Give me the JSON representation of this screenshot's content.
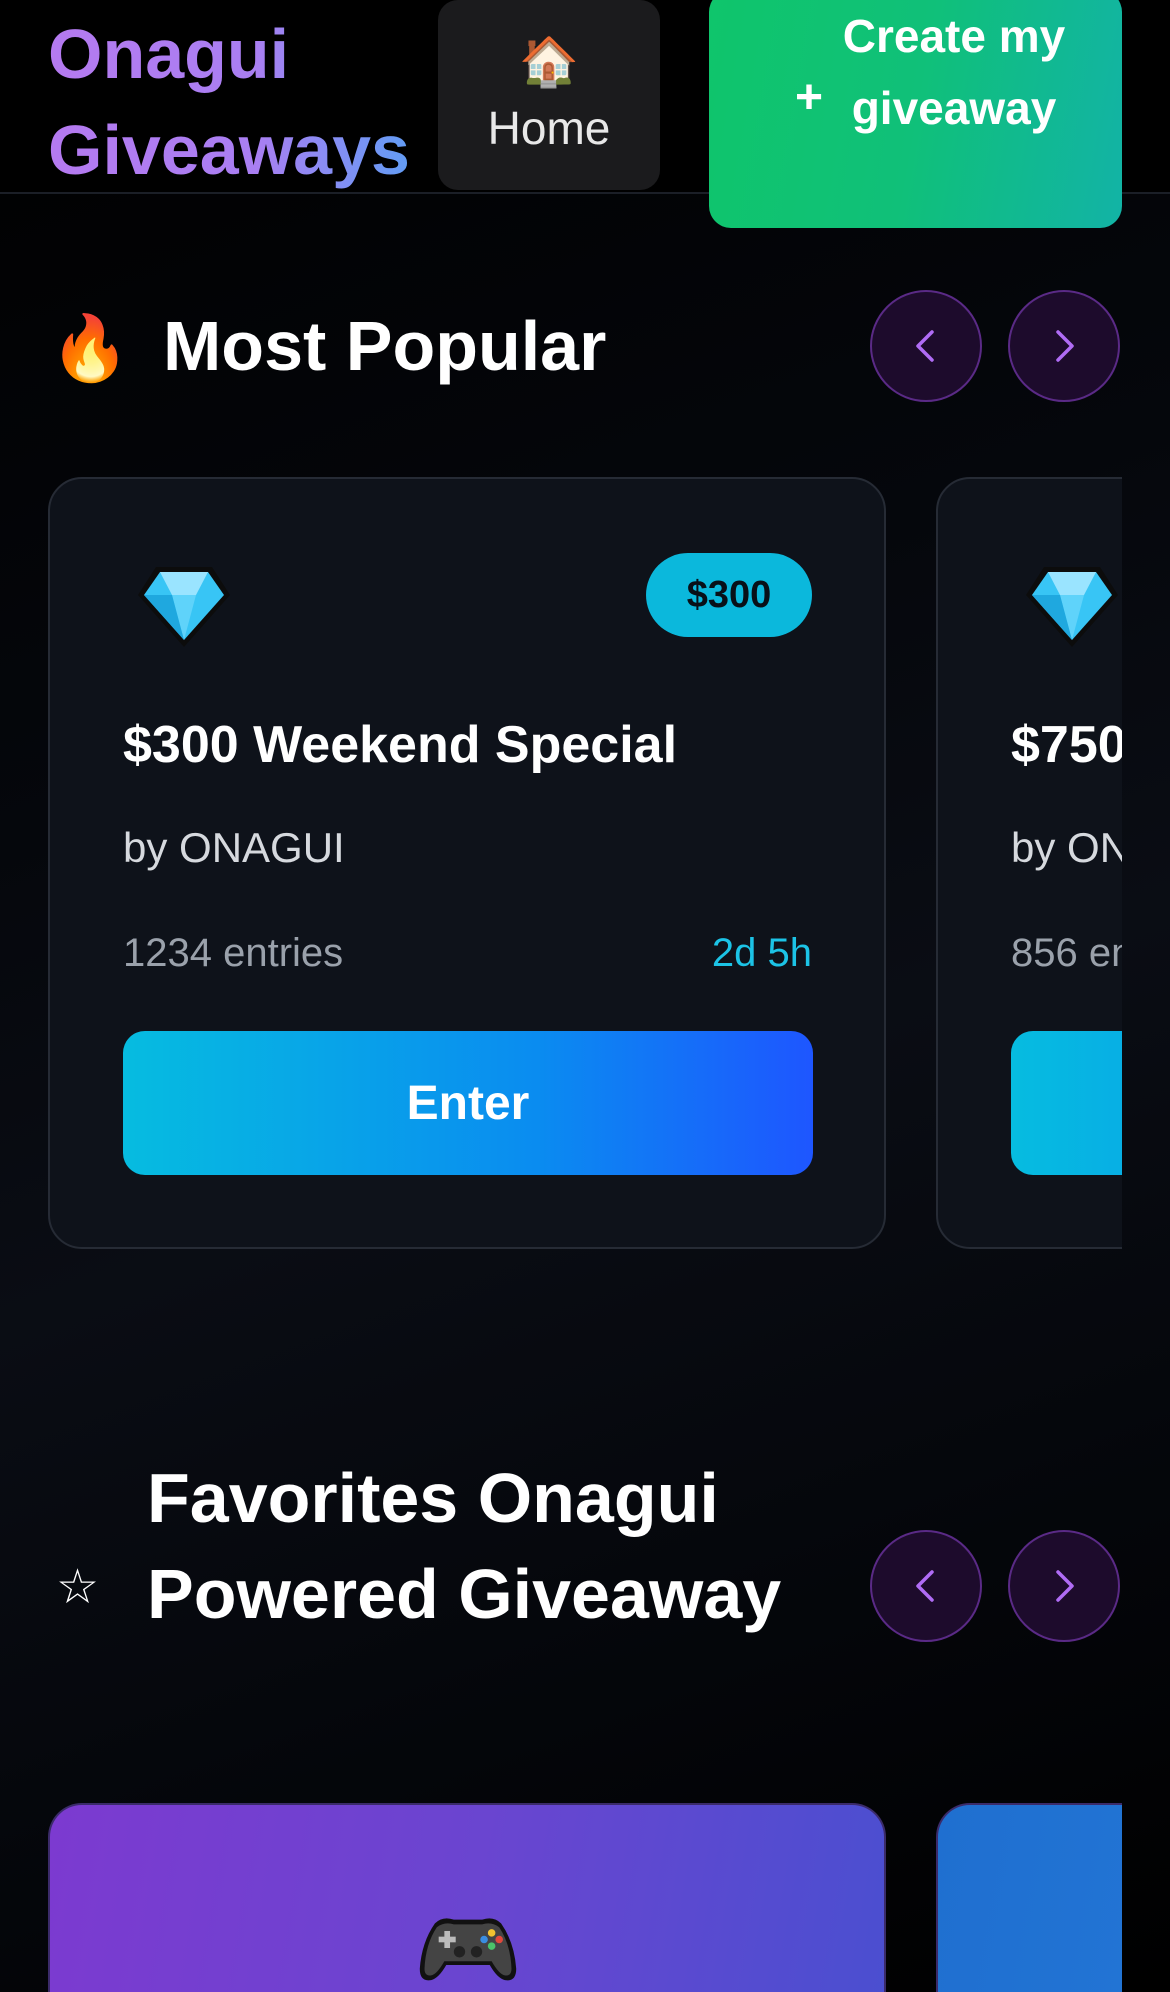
{
  "header": {
    "brand": "Onagui Giveaways",
    "home": {
      "icon": "house-icon",
      "label": "Home"
    },
    "create": {
      "icon": "plus-icon",
      "label": "Create my giveaway"
    }
  },
  "most_popular": {
    "icon": "fire-icon",
    "title": "Most Popular",
    "cards": [
      {
        "icon": "diamond-icon",
        "badge": "$300",
        "title": "$300 Weekend Special",
        "by": "by ONAGUI",
        "entries": "1234 entries",
        "time_left": "2d 5h",
        "button": "Enter"
      },
      {
        "icon": "diamond-icon",
        "title": "$750",
        "by": "by ON",
        "entries": "856 en"
      }
    ]
  },
  "favorites": {
    "icon": "star-icon",
    "title": "Favorites Onagui Powered Giveaway",
    "cards": [
      {
        "icon": "gamepad-icon"
      }
    ]
  },
  "colors": {
    "brand_gradient_start": "#b57af0",
    "brand_gradient_end": "#5aa0f5",
    "create_green": "#10c079",
    "accent_cyan": "#1cc3e6",
    "enter_blue": "#1e56ff",
    "nav_purple": "#5a2a86"
  }
}
